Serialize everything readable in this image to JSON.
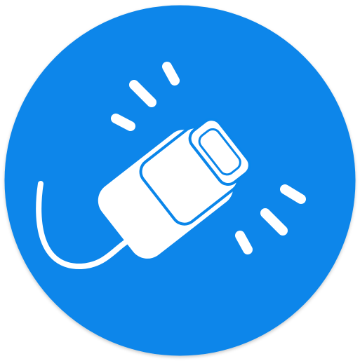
{
  "icon": {
    "name": "plug-connection-icon",
    "background_color": "#0A86EA",
    "foreground_color": "#FFFFFF"
  }
}
